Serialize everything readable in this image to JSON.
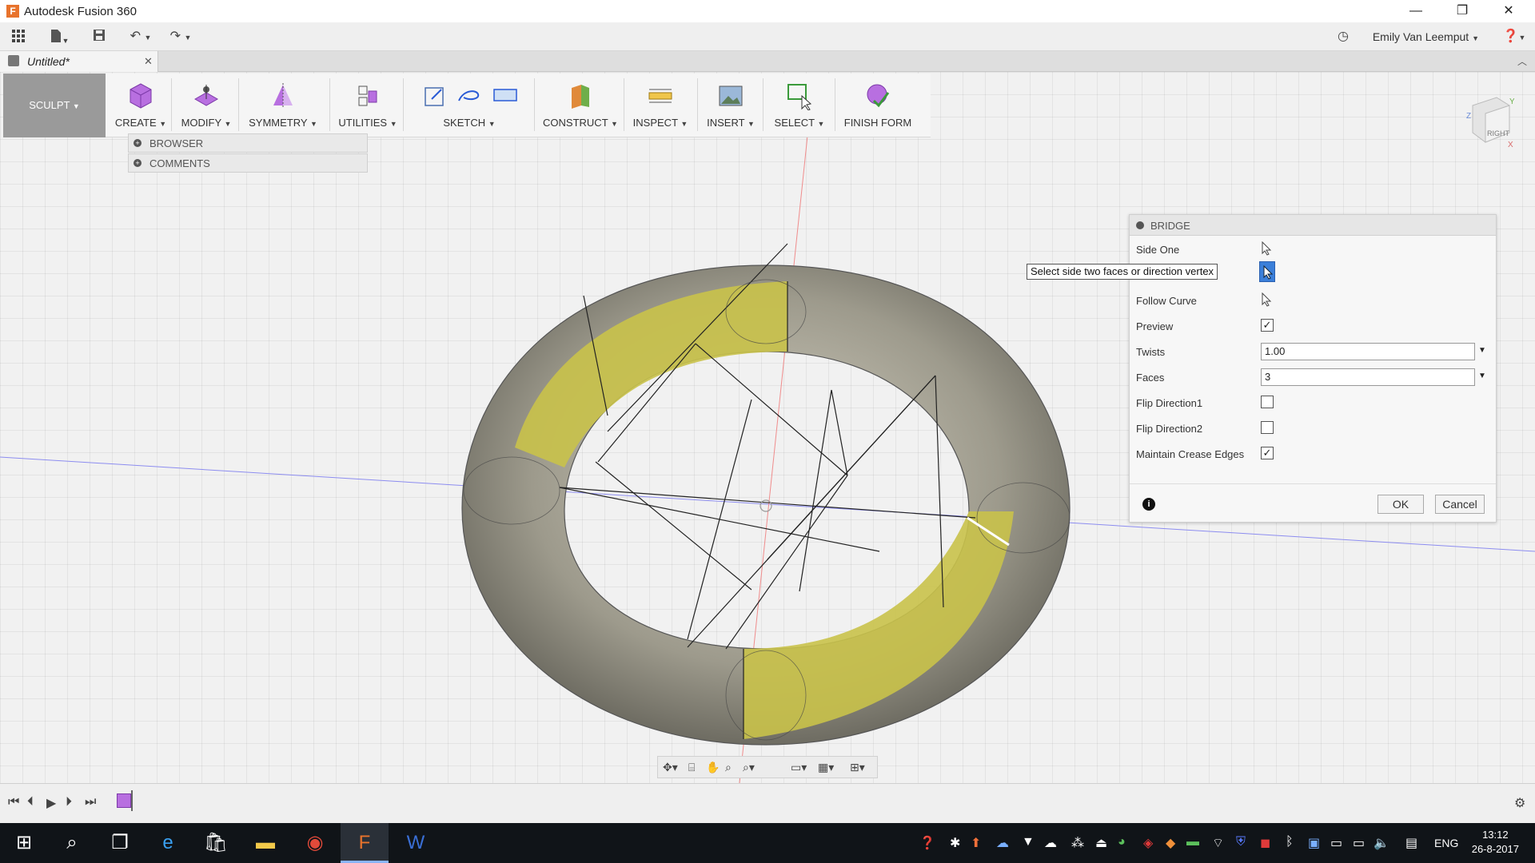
{
  "window": {
    "title": "Autodesk Fusion 360",
    "minimize": "—",
    "maximize": "❐",
    "close": "✕"
  },
  "qat": {
    "grid_icon": "grid-icon",
    "file_icon": "file-icon",
    "save_icon": "save-icon",
    "undo_icon": "undo-icon",
    "redo_icon": "redo-icon",
    "user_name": "Emily Van Leemput",
    "history_icon": "clock-icon",
    "help_icon": "help-icon"
  },
  "tab": {
    "label": "Untitled*",
    "close": "✕"
  },
  "toolbar": {
    "workspace": "SCULPT",
    "groups": {
      "create": "CREATE",
      "modify": "MODIFY",
      "symmetry": "SYMMETRY",
      "utilities": "UTILITIES",
      "sketch": "SKETCH",
      "construct": "CONSTRUCT",
      "inspect": "INSPECT",
      "insert": "INSERT",
      "select": "SELECT",
      "finish": "FINISH FORM"
    }
  },
  "panels": {
    "browser": "BROWSER",
    "comments": "COMMENTS"
  },
  "bridge": {
    "title": "BRIDGE",
    "side_one": "Side One",
    "tooltip": "Select side two faces or direction vertex",
    "follow_curve": "Follow Curve",
    "preview": "Preview",
    "preview_checked": "✓",
    "twists": "Twists",
    "twists_value": "1.00",
    "faces": "Faces",
    "faces_value": "3",
    "flip1": "Flip Direction1",
    "flip2": "Flip Direction2",
    "maintain": "Maintain Crease Edges",
    "maintain_checked": "✓",
    "ok": "OK",
    "cancel": "Cancel"
  },
  "viewcube": {
    "label": "RIGHT",
    "axis_z": "Z",
    "axis_y": "Y",
    "axis_x": "X"
  },
  "taskbar": {
    "language": "ENG",
    "time": "13:12",
    "date": "26-8-2017"
  },
  "colors": {
    "accent": "#e8732c",
    "torus_highlight": "#c9c24a",
    "dialog_bg": "#f7f7f7"
  }
}
